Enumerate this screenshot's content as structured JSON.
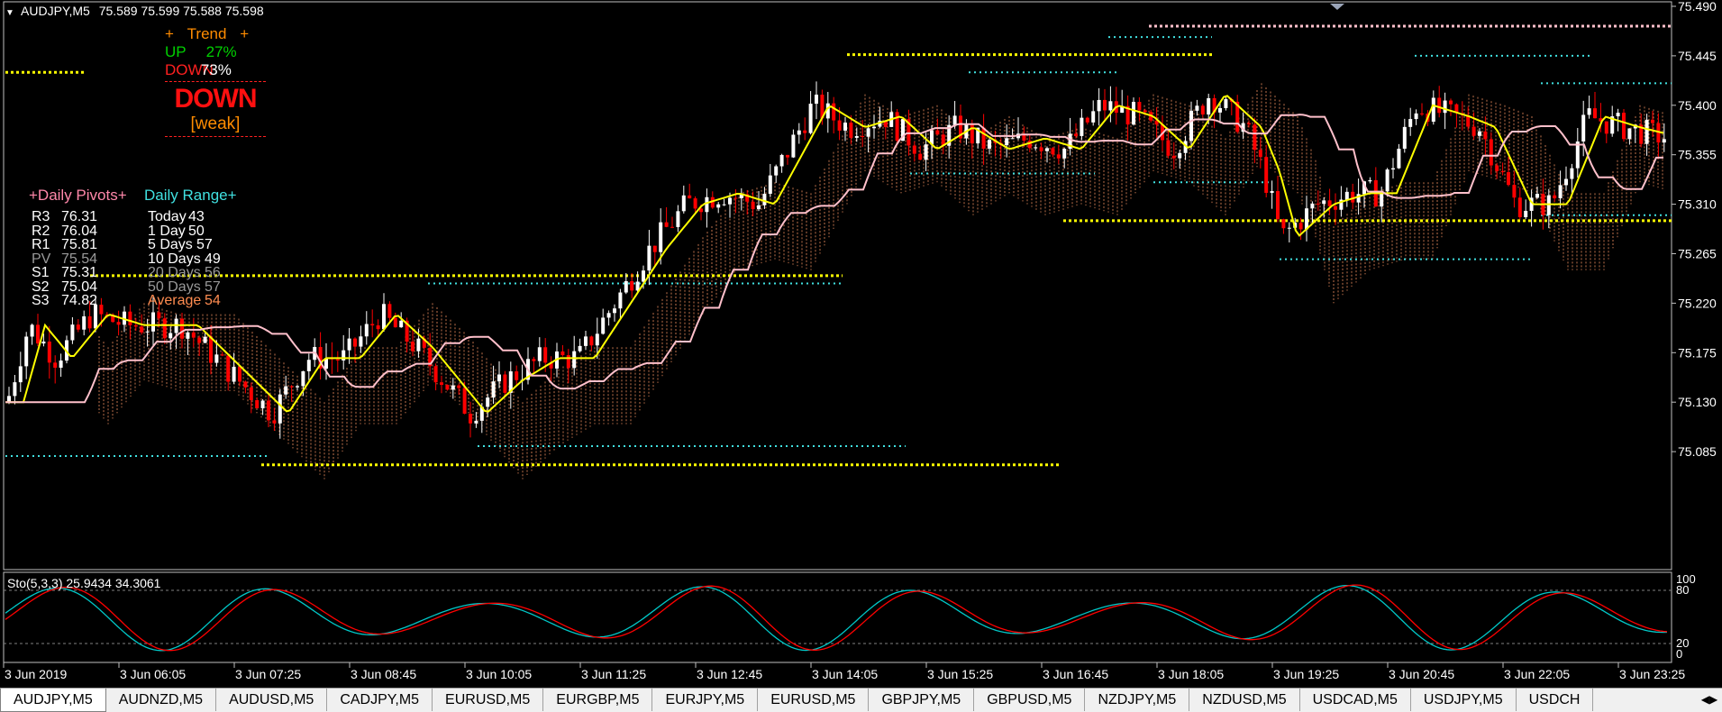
{
  "header": {
    "symbol": "AUDJPY,M5",
    "ohlc": "75.589 75.599 75.588 75.598"
  },
  "trend": {
    "title": "Trend",
    "plus": "+",
    "up_label": "UP",
    "up_value": "27%",
    "down_label": "DOWN",
    "down_value": "73%",
    "signal": "DOWN",
    "strength": "[weak]"
  },
  "pivots": {
    "title": "+Daily Pivots+",
    "rows": [
      {
        "k": "R3",
        "v": "76.31"
      },
      {
        "k": "R2",
        "v": "76.04"
      },
      {
        "k": "R1",
        "v": "75.81"
      },
      {
        "k": "PV",
        "v": "75.54"
      },
      {
        "k": "S1",
        "v": "75.31"
      },
      {
        "k": "S2",
        "v": "75.04"
      },
      {
        "k": "S3",
        "v": "74.82"
      }
    ]
  },
  "range": {
    "title": "Daily Range+",
    "rows": [
      {
        "k": "Today",
        "v": "43"
      },
      {
        "k": "1 Day",
        "v": "50"
      },
      {
        "k": "5 Days",
        "v": "57"
      },
      {
        "k": "10 Days",
        "v": "49"
      },
      {
        "k": "20 Days",
        "v": "56"
      },
      {
        "k": "50 Days",
        "v": "57"
      },
      {
        "k": "Average",
        "v": "54"
      }
    ]
  },
  "price_axis": [
    "75.490",
    "75.445",
    "75.400",
    "75.355",
    "75.310",
    "75.265",
    "75.220",
    "75.175",
    "75.130",
    "75.085"
  ],
  "stoch": {
    "label": "Sto(5,3,3) 25.9434 34.3061",
    "levels": [
      "100",
      "80",
      "20",
      "0"
    ]
  },
  "time_axis": [
    "3 Jun 2019",
    "3 Jun 06:05",
    "3 Jun 07:25",
    "3 Jun 08:45",
    "3 Jun 10:05",
    "3 Jun 11:25",
    "3 Jun 12:45",
    "3 Jun 14:05",
    "3 Jun 15:25",
    "3 Jun 16:45",
    "3 Jun 18:05",
    "3 Jun 19:25",
    "3 Jun 20:45",
    "3 Jun 22:05",
    "3 Jun 23:25"
  ],
  "tabs": [
    "AUDJPY,M5",
    "AUDNZD,M5",
    "AUDUSD,M5",
    "CADJPY,M5",
    "EURUSD,M5",
    "EURGBP,M5",
    "EURJPY,M5",
    "EURUSD,M5",
    "GBPJPY,M5",
    "GBPUSD,M5",
    "NZDJPY,M5",
    "NZDUSD,M5",
    "USDCAD,M5",
    "USDJPY,M5",
    "USDCH"
  ],
  "colors": {
    "bull": "#ffffff",
    "bear": "#ff0000",
    "ma_fast": "#ffff00",
    "ma_slow": "#ffc0cb",
    "support": "#ffff00",
    "level": "#40e0e0",
    "cloud": "#ff9966",
    "stoch_main": "#00c8c8",
    "stoch_signal": "#ff0000"
  }
}
